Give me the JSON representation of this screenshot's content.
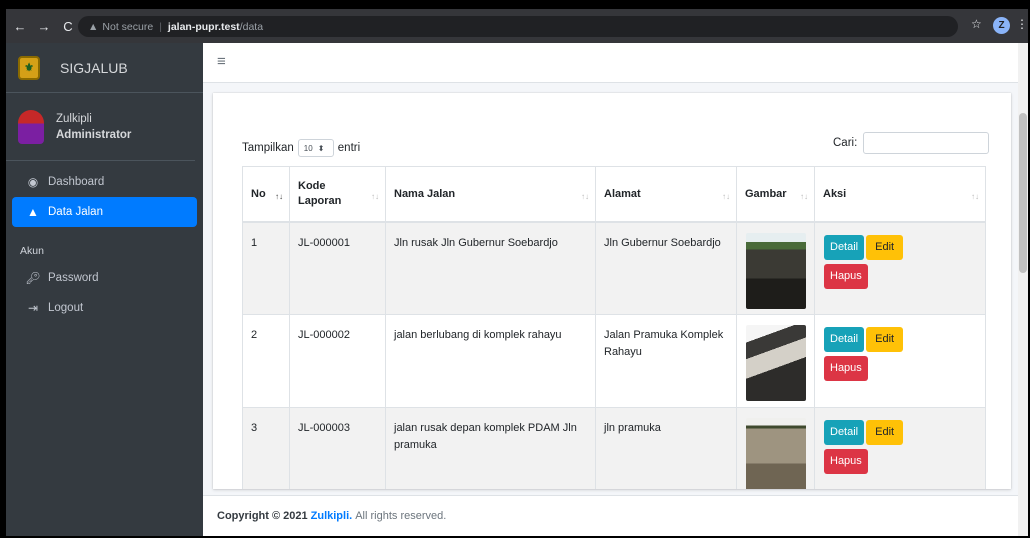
{
  "browser": {
    "security_label": "Not secure",
    "url_host": "jalan-pupr.test",
    "url_path": "/data",
    "profile_initial": "Z"
  },
  "sidebar": {
    "brand": "SIGJALUB",
    "user": {
      "name": "Zulkipli",
      "role": "Administrator"
    },
    "items": [
      {
        "label": "Dashboard",
        "icon": "palette-icon"
      },
      {
        "label": "Data Jalan",
        "icon": "road-icon",
        "active": true
      }
    ],
    "section_header": "Akun",
    "account_items": [
      {
        "label": "Password",
        "icon": "key-icon"
      },
      {
        "label": "Logout",
        "icon": "sign-out-icon"
      }
    ]
  },
  "table_controls": {
    "length_prefix": "Tampilkan",
    "length_value": "10",
    "length_suffix": "entri",
    "search_label": "Cari:"
  },
  "table": {
    "headers": [
      "No",
      "Kode Laporan",
      "Nama Jalan",
      "Alamat",
      "Gambar",
      "Aksi"
    ],
    "rows": [
      {
        "no": "1",
        "kode": "JL-000001",
        "nama": "Jln rusak Jln Gubernur Soebardjo",
        "alamat": "Jln Gubernur Soebardjo"
      },
      {
        "no": "2",
        "kode": "JL-000002",
        "nama": "jalan berlubang di komplek rahayu",
        "alamat": "Jalan Pramuka Komplek Rahayu"
      },
      {
        "no": "3",
        "kode": "JL-000003",
        "nama": "jalan rusak depan komplek PDAM Jln pramuka",
        "alamat": "jln pramuka"
      }
    ],
    "actions": {
      "detail": "Detail",
      "edit": "Edit",
      "hapus": "Hapus"
    }
  },
  "footer": {
    "prefix": "Copyright © 2021",
    "author": "Zulkipli.",
    "suffix": "All rights reserved."
  },
  "colors": {
    "primary": "#007bff",
    "info": "#17a2b8",
    "warning": "#ffc107",
    "danger": "#dc3545",
    "sidebar": "#343a40"
  }
}
